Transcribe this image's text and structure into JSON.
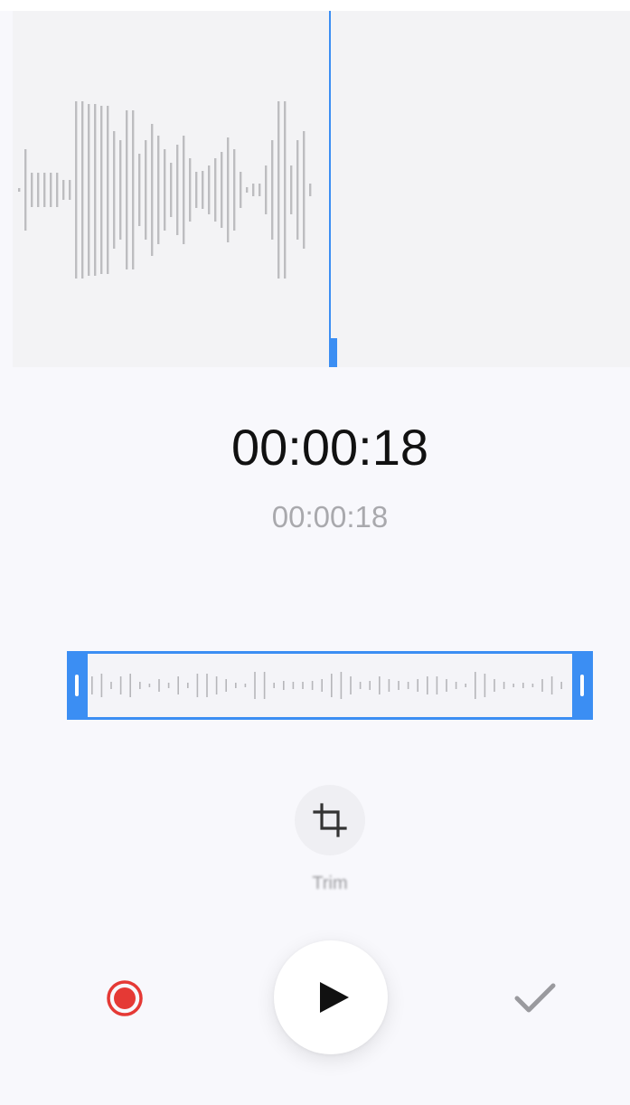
{
  "player": {
    "current_time": "00:00:18",
    "total_time": "00:00:18",
    "accent_color": "#3b8ef3",
    "record_color": "#e53935"
  },
  "trim": {
    "label": "Trim",
    "icon": "crop-icon"
  },
  "controls": {
    "record_icon": "record-icon",
    "play_icon": "play-icon",
    "done_icon": "checkmark-icon"
  }
}
